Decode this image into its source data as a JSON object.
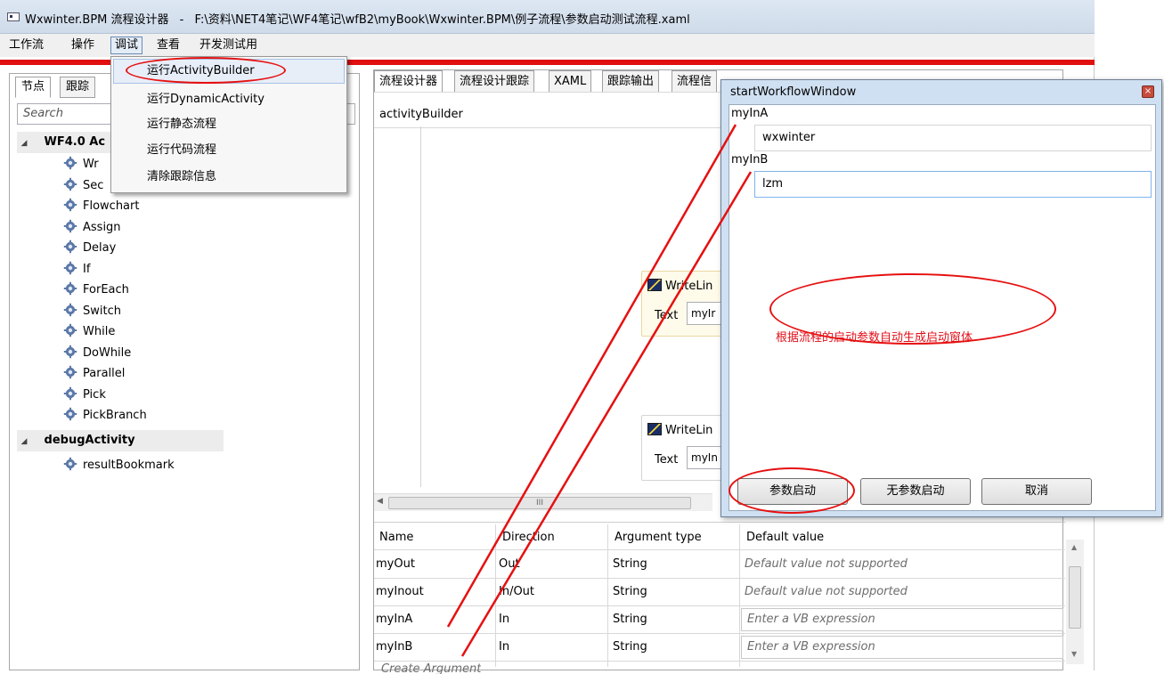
{
  "window": {
    "title_app": "Wxwinter.BPM 流程设计器",
    "title_sep": "-",
    "title_path": "F:\\资料\\NET4笔记\\WF4笔记\\wfB2\\myBook\\Wxwinter.BPM\\例子流程\\参数启动测试流程.xaml"
  },
  "menubar": {
    "items": [
      "工作流",
      "操作",
      "调试",
      "查看",
      "开发测试用"
    ]
  },
  "debug_menu": {
    "items": [
      "运行ActivityBuilder",
      "运行DynamicActivity",
      "运行静态流程",
      "运行代码流程",
      "清除跟踪信息"
    ]
  },
  "left_panel": {
    "tabs": [
      "节点",
      "跟踪"
    ],
    "search_placeholder": "Search",
    "groups": [
      {
        "name": "WF4.0 Ac",
        "items": [
          "Wr",
          "Sec",
          "Flowchart",
          "Assign",
          "Delay",
          "If",
          "ForEach",
          "Switch",
          "While",
          "DoWhile",
          "Parallel",
          "Pick",
          "PickBranch"
        ]
      },
      {
        "name": "debugActivity",
        "items": [
          "resultBookmark"
        ]
      }
    ]
  },
  "designer": {
    "tabs": [
      "流程设计器",
      "流程设计跟踪",
      "XAML",
      "跟踪输出",
      "流程信"
    ],
    "breadcrumb": "activityBuilder",
    "activities": [
      {
        "title": "WriteLin",
        "label": "Text",
        "value": "myIr"
      },
      {
        "title": "WriteLin",
        "label": "Text",
        "value": "myIn"
      }
    ],
    "scroll_thumb": "III"
  },
  "arguments": {
    "headers": [
      "Name",
      "Direction",
      "Argument type",
      "Default value"
    ],
    "rows": [
      {
        "name": "myOut",
        "direction": "Out",
        "type": "String",
        "default": "Default value not supported"
      },
      {
        "name": "myInout",
        "direction": "In/Out",
        "type": "String",
        "default": "Default value not supported"
      },
      {
        "name": "myInA",
        "direction": "In",
        "type": "String",
        "default": "Enter a VB expression"
      },
      {
        "name": "myInB",
        "direction": "In",
        "type": "String",
        "default": "Enter a VB expression"
      }
    ],
    "footer": "Create Argument"
  },
  "dialog": {
    "title": "startWorkflowWindow",
    "close_glyph": "×",
    "fields": [
      {
        "label": "myInA",
        "value": "wxwinter"
      },
      {
        "label": "myInB",
        "value": "lzm"
      }
    ],
    "note": "根据流程的启动参数自动生成启动窗体",
    "buttons": [
      "参数启动",
      "无参数启动",
      "取消"
    ]
  },
  "colors": {
    "accent_red": "#e01010",
    "dialog_frame": "#cfe0f2",
    "selection": "#e7eef8"
  }
}
